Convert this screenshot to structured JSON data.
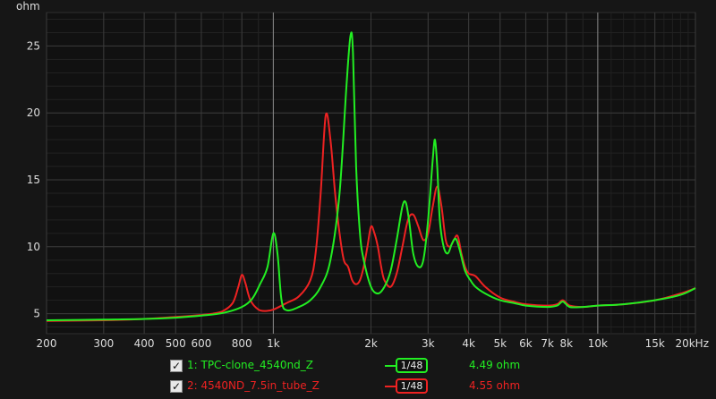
{
  "chart_data": {
    "type": "line",
    "title": "",
    "ylabel": "ohm",
    "xlabel": "",
    "x_scale": "log",
    "xlim": [
      200,
      20000
    ],
    "ylim": [
      3.5,
      27.5
    ],
    "grid": true,
    "x_ticks": [
      {
        "value": 200,
        "label": "200"
      },
      {
        "value": 300,
        "label": "300"
      },
      {
        "value": 400,
        "label": "400"
      },
      {
        "value": 500,
        "label": "500"
      },
      {
        "value": 600,
        "label": "600"
      },
      {
        "value": 800,
        "label": "800"
      },
      {
        "value": 1000,
        "label": "1k"
      },
      {
        "value": 2000,
        "label": "2k"
      },
      {
        "value": 3000,
        "label": "3k"
      },
      {
        "value": 4000,
        "label": "4k"
      },
      {
        "value": 5000,
        "label": "5k"
      },
      {
        "value": 6000,
        "label": "6k"
      },
      {
        "value": 7000,
        "label": "7k"
      },
      {
        "value": 8000,
        "label": "8k"
      },
      {
        "value": 10000,
        "label": "10k"
      },
      {
        "value": 15000,
        "label": "15k"
      },
      {
        "value": 20000,
        "label": "20kHz"
      }
    ],
    "y_ticks": [
      5,
      10,
      15,
      20,
      25
    ],
    "series": [
      {
        "name": "1: TPC-clone_4540nd_Z",
        "color": "#22ee22",
        "smoothing": "1/48",
        "value_text": "4.49 ohm",
        "x": [
          200,
          300,
          400,
          500,
          600,
          700,
          800,
          860,
          910,
          960,
          1000,
          1030,
          1060,
          1100,
          1200,
          1300,
          1400,
          1500,
          1600,
          1680,
          1730,
          1760,
          1800,
          1850,
          1900,
          2000,
          2100,
          2200,
          2300,
          2400,
          2500,
          2560,
          2620,
          2700,
          2800,
          2900,
          3000,
          3100,
          3150,
          3200,
          3260,
          3350,
          3450,
          3550,
          3650,
          3750,
          3900,
          4050,
          4200,
          4500,
          5000,
          5500,
          6000,
          7000,
          7500,
          7800,
          8200,
          9000,
          10000,
          12000,
          15000,
          18000,
          20000
        ],
        "y": [
          4.5,
          4.55,
          4.6,
          4.7,
          4.85,
          5.05,
          5.5,
          6.1,
          7.2,
          8.5,
          11.0,
          9.5,
          6.0,
          5.25,
          5.5,
          6.0,
          7.0,
          9.0,
          14.0,
          22.0,
          25.8,
          24.5,
          16.0,
          11.0,
          9.0,
          7.0,
          6.5,
          7.0,
          8.2,
          10.5,
          13.0,
          13.3,
          12.0,
          9.5,
          8.5,
          9.0,
          12.0,
          16.5,
          18.0,
          16.0,
          12.0,
          10.0,
          9.5,
          10.2,
          10.6,
          9.8,
          8.2,
          7.5,
          7.0,
          6.5,
          6.0,
          5.8,
          5.6,
          5.5,
          5.6,
          5.9,
          5.5,
          5.5,
          5.6,
          5.7,
          6.0,
          6.4,
          6.9
        ]
      },
      {
        "name": "2: 4540ND_7.5in_tube_Z",
        "color": "#ee2222",
        "smoothing": "1/48",
        "value_text": "4.55 ohm",
        "x": [
          200,
          300,
          400,
          500,
          600,
          650,
          700,
          750,
          780,
          800,
          820,
          850,
          900,
          950,
          1000,
          1100,
          1200,
          1300,
          1350,
          1400,
          1450,
          1500,
          1550,
          1600,
          1650,
          1700,
          1750,
          1800,
          1850,
          1900,
          1950,
          2000,
          2050,
          2100,
          2150,
          2200,
          2300,
          2400,
          2500,
          2600,
          2700,
          2800,
          2900,
          3000,
          3100,
          3200,
          3300,
          3400,
          3500,
          3600,
          3700,
          3800,
          3900,
          4000,
          4200,
          4500,
          5000,
          5500,
          6000,
          7000,
          7500,
          7800,
          8200,
          9000,
          10000,
          12000,
          15000,
          18000,
          20000
        ],
        "y": [
          4.45,
          4.5,
          4.6,
          4.75,
          4.9,
          5.0,
          5.2,
          5.8,
          7.0,
          7.9,
          7.3,
          6.0,
          5.3,
          5.2,
          5.3,
          5.8,
          6.3,
          7.5,
          9.5,
          14.0,
          19.8,
          18.0,
          14.0,
          11.0,
          9.0,
          8.5,
          7.5,
          7.2,
          7.5,
          8.5,
          10.0,
          11.5,
          11.0,
          10.0,
          8.5,
          7.5,
          7.0,
          8.0,
          10.0,
          12.0,
          12.4,
          11.5,
          10.5,
          11.0,
          13.0,
          14.5,
          13.0,
          10.5,
          10.0,
          10.5,
          10.8,
          9.5,
          8.5,
          8.0,
          7.8,
          7.0,
          6.2,
          5.9,
          5.7,
          5.6,
          5.7,
          6.0,
          5.6,
          5.5,
          5.6,
          5.7,
          6.0,
          6.5,
          6.9
        ]
      }
    ]
  }
}
